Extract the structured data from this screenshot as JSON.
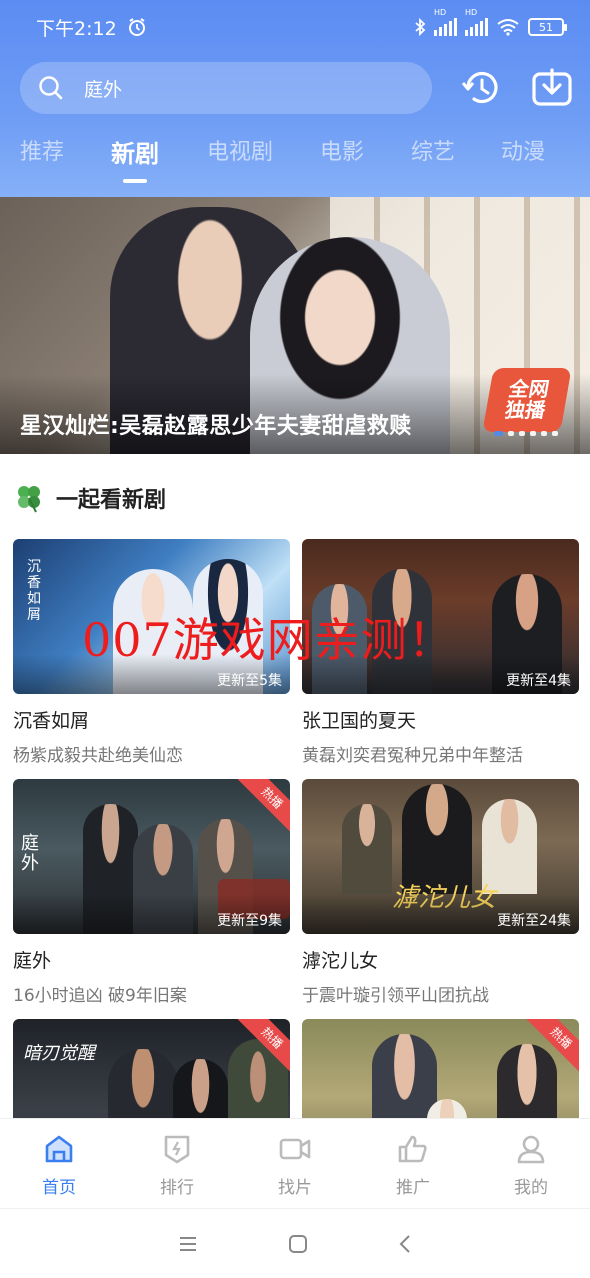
{
  "status": {
    "time": "下午2:12",
    "battery": "51",
    "hd1": "HD",
    "hd2": "HD"
  },
  "search": {
    "value": "庭外"
  },
  "tabs": [
    "推荐",
    "新剧",
    "电视剧",
    "电影",
    "综艺",
    "动漫"
  ],
  "active_tab": 1,
  "banner": {
    "caption": "星汉灿烂:吴磊赵露思少年夫妻甜虐救赎",
    "badge_line1": "全网",
    "badge_line2": "独播",
    "dot_count": 6,
    "active_dot": 0
  },
  "section": {
    "title": "一起看新剧",
    "icon": "clover-icon"
  },
  "watermark": "007游戏网亲测！",
  "cards": [
    {
      "title": "沉香如屑",
      "subtitle": "杨紫成毅共赴绝美仙恋",
      "update": "更新至5集",
      "hot": "",
      "poster_text": "沉香如屑"
    },
    {
      "title": "张卫国的夏天",
      "subtitle": "黄磊刘奕君冤种兄弟中年整活",
      "update": "更新至4集",
      "hot": "",
      "poster_text": ""
    },
    {
      "title": "庭外",
      "subtitle": "16小时追凶 破9年旧案",
      "update": "更新至9集",
      "hot": "热播",
      "poster_text": "庭外"
    },
    {
      "title": "滹沱儿女",
      "subtitle": "于震叶璇引领平山团抗战",
      "update": "更新至24集",
      "hot": "",
      "poster_text": "滹沱儿女"
    },
    {
      "title": "",
      "subtitle": "",
      "update": "",
      "hot": "热播",
      "poster_text": "暗刃觉醒"
    },
    {
      "title": "",
      "subtitle": "",
      "update": "",
      "hot": "热播",
      "poster_text": ""
    }
  ],
  "nav": [
    {
      "label": "首页",
      "icon": "home-icon"
    },
    {
      "label": "排行",
      "icon": "ranking-icon"
    },
    {
      "label": "找片",
      "icon": "video-camera-icon"
    },
    {
      "label": "推广",
      "icon": "thumbs-up-icon"
    },
    {
      "label": "我的",
      "icon": "profile-icon"
    }
  ],
  "colors": {
    "accent": "#3a7ff0",
    "header_top": "#5b8cf2",
    "hot": "#e84a4a",
    "watermark": "#ee1d1d"
  }
}
